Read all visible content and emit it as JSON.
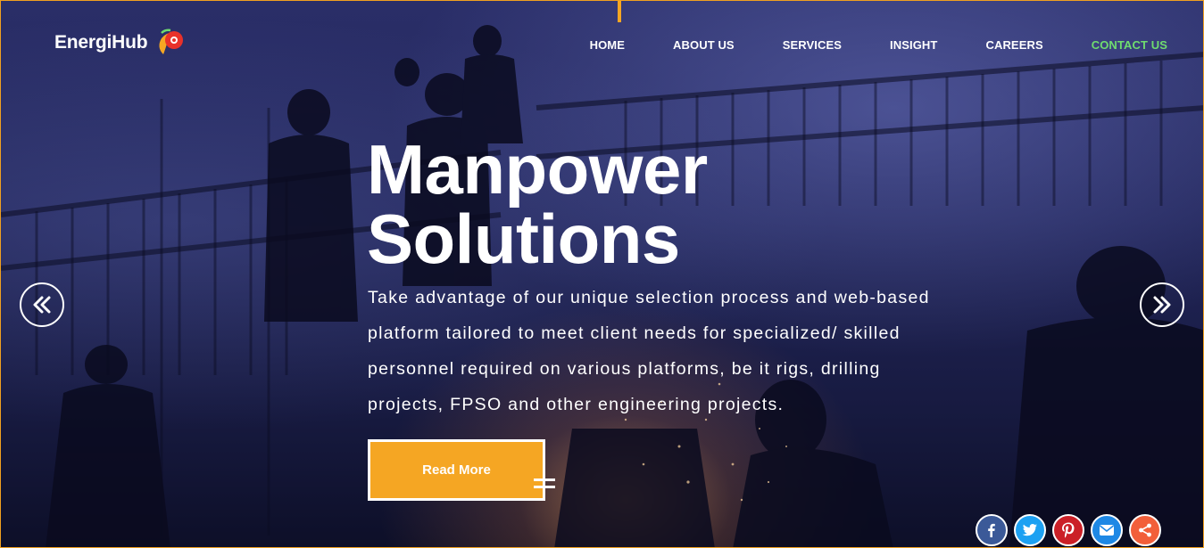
{
  "brand": {
    "name": "EnergiHub",
    "logo_icon": "energihub-logo-mark",
    "colors": {
      "accent": "#f5a623",
      "logo_red": "#e8312a",
      "logo_orange": "#f5a623",
      "logo_green": "#6fdc6f"
    }
  },
  "nav": {
    "items": [
      {
        "label": "HOME"
      },
      {
        "label": "ABOUT US"
      },
      {
        "label": "SERVICES"
      },
      {
        "label": "INSIGHT"
      },
      {
        "label": "CAREERS"
      },
      {
        "label": "CONTACT US"
      }
    ],
    "active_color": "#6fdc6f"
  },
  "hero": {
    "headline_line1": "Manpower",
    "headline_line2": "Solutions",
    "description": "Take advantage of our unique selection process and web-based platform tailored to meet client needs for specialized/ skilled personnel required on various platforms, be it rigs, drilling projects, FPSO and other engineering projects.",
    "cta_label": "Read More",
    "cta_color": "#f5a623"
  },
  "carousel": {
    "prev_icon": "double-chevron-left-icon",
    "next_icon": "double-chevron-right-icon"
  },
  "social": [
    {
      "name": "facebook",
      "icon": "facebook-icon",
      "color": "#3b5998"
    },
    {
      "name": "twitter",
      "icon": "twitter-icon",
      "color": "#1da1f2"
    },
    {
      "name": "pinterest",
      "icon": "pinterest-icon",
      "color": "#cb2027"
    },
    {
      "name": "email",
      "icon": "email-icon",
      "color": "#1e88e5"
    },
    {
      "name": "share",
      "icon": "share-icon",
      "color": "#f25f3a"
    }
  ]
}
